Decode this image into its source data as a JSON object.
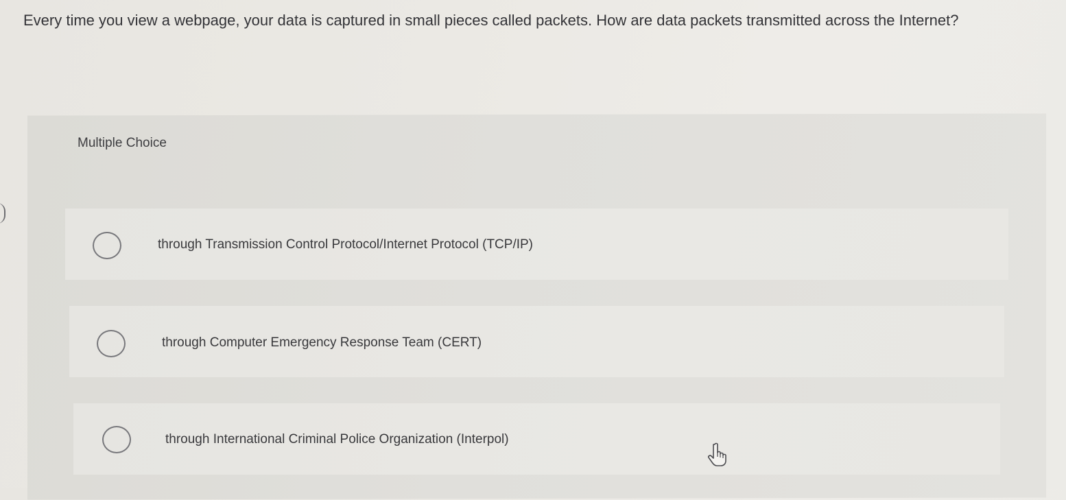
{
  "question": {
    "text": "Every time you view a webpage, your data is captured in small pieces called packets. How are data packets transmitted across the Internet?"
  },
  "multiple_choice": {
    "label": "Multiple Choice",
    "options": [
      {
        "label": "through Transmission Control Protocol/Internet Protocol (TCP/IP)",
        "selected": false
      },
      {
        "label": "through Computer Emergency Response Team (CERT)",
        "selected": false
      },
      {
        "label": "through International Criminal Police Organization (Interpol)",
        "selected": false
      }
    ]
  },
  "icons": {
    "radio": "radio-circle-icon",
    "cursor": "hand-pointer-icon"
  },
  "colors": {
    "page_background": "#ebe9e4",
    "panel_background": "#dfded9",
    "option_background": "#e8e7e3",
    "text": "#333337",
    "radio_border": "#77777b"
  }
}
